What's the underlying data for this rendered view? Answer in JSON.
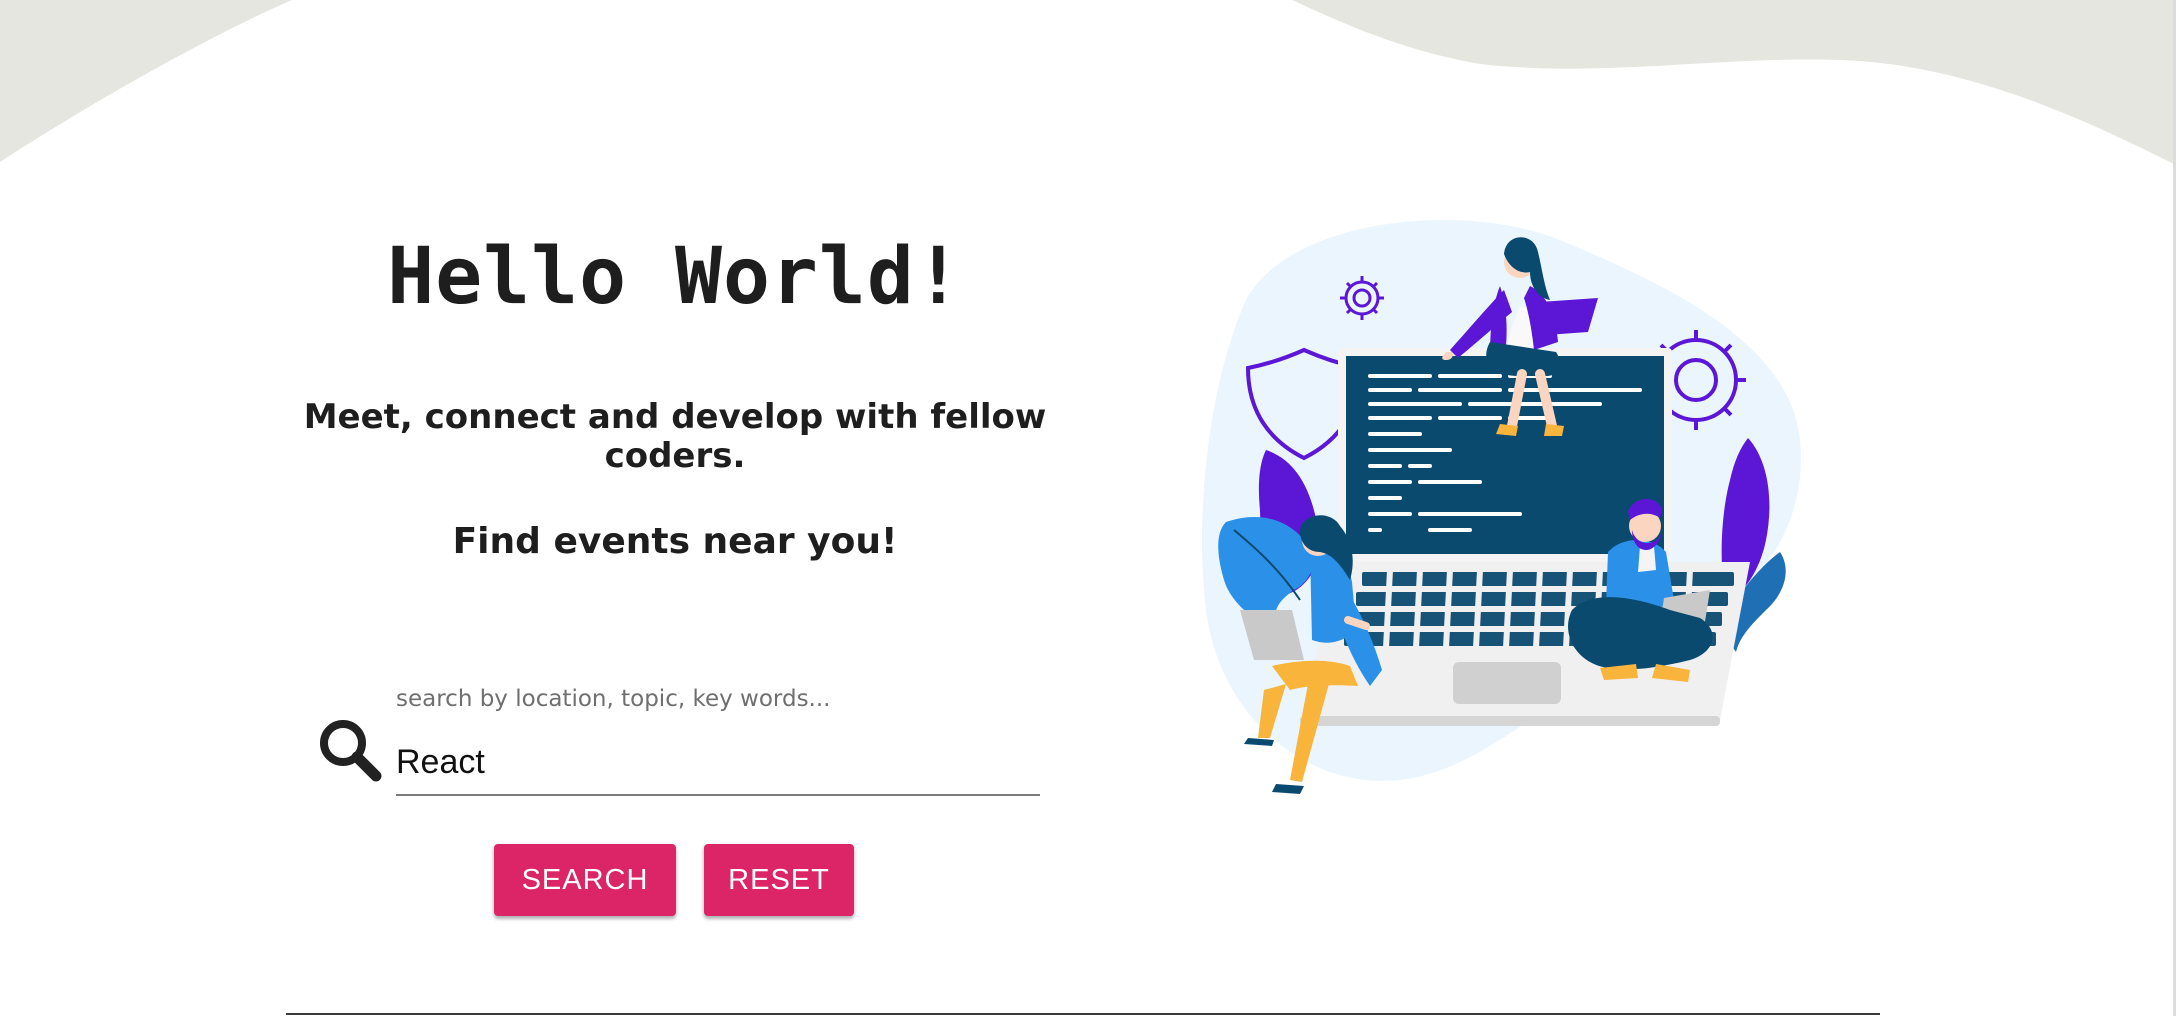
{
  "hero": {
    "heading": "Hello World!",
    "tagline": "Meet, connect and develop with fellow coders.",
    "subtagline": "Find events near you!"
  },
  "search": {
    "label": "search by location, topic, key words...",
    "value": "React",
    "icon": "search-icon"
  },
  "actions": {
    "search_label": "SEARCH",
    "reset_label": "RESET"
  },
  "illustration": {
    "subject": "hero-illustration"
  },
  "colors": {
    "accent": "#db2566",
    "wave": "#e6e6e1",
    "text": "#1e1e1e",
    "screen": "#0b4a6f",
    "purple": "#5b16d6",
    "blue": "#2b91e8"
  }
}
